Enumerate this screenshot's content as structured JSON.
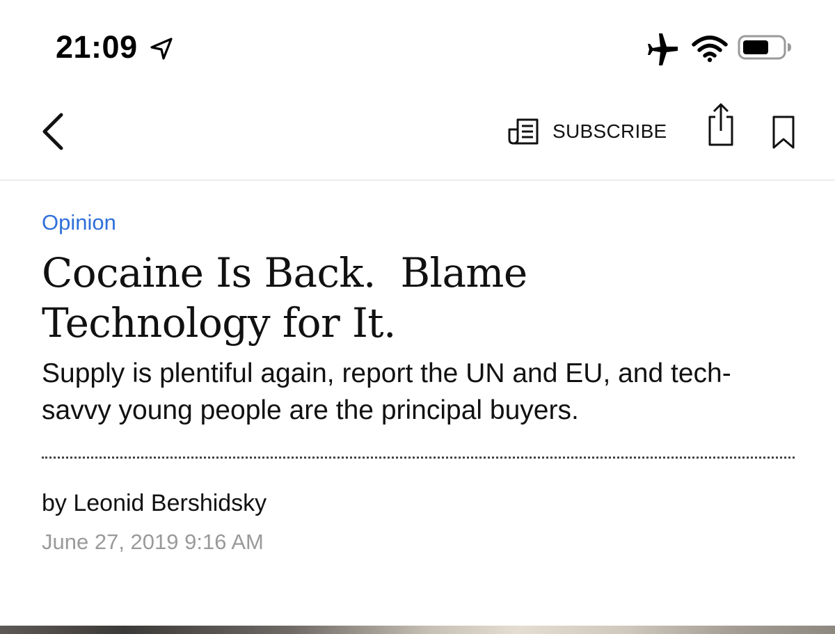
{
  "status_bar": {
    "time": "21:09"
  },
  "nav": {
    "subscribe_label": "SUBSCRIBE"
  },
  "article": {
    "category": "Opinion",
    "headline": "Cocaine Is Back.  Blame Technology for It.",
    "dek": "Supply is plentiful again, report the UN and EU, and tech-savvy young people are the principal buyers.",
    "byline_prefix": "by ",
    "author": "Leonid Bershidsky",
    "timestamp": "June 27, 2019 9:16 AM"
  },
  "icons": {
    "location": "location-arrow-icon",
    "airplane": "airplane-icon",
    "wifi": "wifi-icon",
    "battery": "battery-icon",
    "back": "chevron-left-icon",
    "subscribe": "newspaper-icon",
    "share": "share-icon",
    "bookmark": "bookmark-icon"
  },
  "colors": {
    "category": "#2f6fd9",
    "timestamp": "#9a9a9a",
    "text": "#111111"
  }
}
